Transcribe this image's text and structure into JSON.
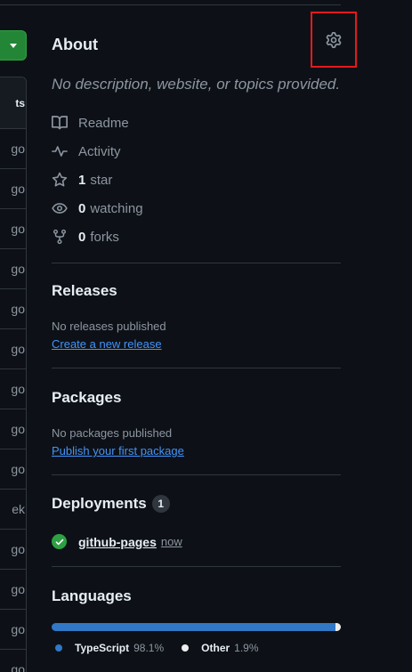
{
  "file_list": {
    "header_fragment": "ts",
    "ages": [
      "go",
      "go",
      "go",
      "go",
      "go",
      "go",
      "go",
      "go",
      "go",
      "ek",
      "go",
      "go",
      "go",
      "go"
    ]
  },
  "about": {
    "title": "About",
    "description": "No description, website, or topics provided.",
    "readme_label": "Readme",
    "activity_label": "Activity",
    "stars_count": "1",
    "stars_label": "star",
    "watching_count": "0",
    "watching_label": "watching",
    "forks_count": "0",
    "forks_label": "forks"
  },
  "releases": {
    "title": "Releases",
    "empty_text": "No releases published",
    "create_link": "Create a new release"
  },
  "packages": {
    "title": "Packages",
    "empty_text": "No packages published",
    "publish_link": "Publish your first package"
  },
  "deployments": {
    "title": "Deployments",
    "count": "1",
    "items": [
      {
        "name": "github-pages",
        "time": "now",
        "status_color": "#2ea043"
      }
    ]
  },
  "languages": {
    "title": "Languages",
    "items": [
      {
        "name": "TypeScript",
        "percent": "98.1%",
        "share": 98.1,
        "color": "#3178c6"
      },
      {
        "name": "Other",
        "percent": "1.9%",
        "share": 1.9,
        "color": "#ededed"
      }
    ]
  },
  "colors": {
    "background": "#0d1117",
    "border": "#30363d",
    "muted_text": "#8d96a0",
    "link": "#4493f8",
    "highlight_box": "#e5191b",
    "primary_button": "#238636"
  }
}
